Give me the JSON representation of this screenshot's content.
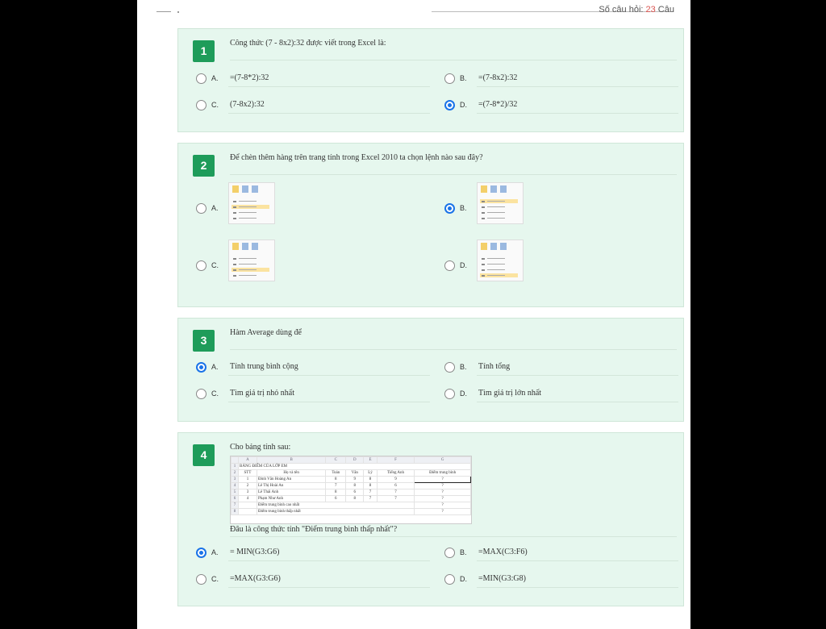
{
  "header": {
    "count_label": "Số câu hỏi: ",
    "count_value": "23",
    "count_unit": " Câu"
  },
  "questions": [
    {
      "number": "1",
      "text": "Công thức (7 - 8x2):32 được viết trong Excel là:",
      "options": [
        {
          "letter": "A.",
          "text": "=(7-8*2):32",
          "selected": false
        },
        {
          "letter": "B.",
          "text": "=(7-8x2):32",
          "selected": false
        },
        {
          "letter": "C.",
          "text": "(7-8x2):32",
          "selected": false
        },
        {
          "letter": "D.",
          "text": "=(7-8*2)/32",
          "selected": true
        }
      ]
    },
    {
      "number": "2",
      "text": "Để chèn thêm hàng trên trang tính trong Excel 2010 ta chọn lệnh nào sau đây?",
      "options": [
        {
          "letter": "A.",
          "highlight_row": 1,
          "selected": false
        },
        {
          "letter": "B.",
          "highlight_row": 0,
          "selected": true
        },
        {
          "letter": "C.",
          "highlight_row": 2,
          "selected": false
        },
        {
          "letter": "D.",
          "highlight_row": 3,
          "selected": false
        }
      ]
    },
    {
      "number": "3",
      "text": "Hàm Average dùng để",
      "options": [
        {
          "letter": "A.",
          "text": "Tính trung bình cộng",
          "selected": true
        },
        {
          "letter": "B.",
          "text": "Tính tổng",
          "selected": false
        },
        {
          "letter": "C.",
          "text": "Tìm giá trị nhỏ nhất",
          "selected": false
        },
        {
          "letter": "D.",
          "text": "Tìm giá trị lớn nhất",
          "selected": false
        }
      ]
    },
    {
      "number": "4",
      "text": "Cho bảng tính sau:",
      "sub_text": "Đâu là công thức tính \"Điểm trung bình thấp nhất\"?",
      "sheet": {
        "col_headers": [
          "A",
          "B",
          "C",
          "D",
          "E",
          "F",
          "G"
        ],
        "title": "BẢNG ĐIỂM CỦA LỚP EM",
        "headers": [
          "STT",
          "Họ và tên",
          "Toán",
          "Văn",
          "Lý",
          "Tiếng Anh",
          "Điểm trung bình"
        ],
        "rows": [
          [
            "1",
            "Đinh Văn Hoàng An",
            "8",
            "9",
            "8",
            "9",
            "?"
          ],
          [
            "2",
            "Lê Thị Hoài An",
            "7",
            "8",
            "8",
            "6",
            "?"
          ],
          [
            "3",
            "Lê Thái Anh",
            "8",
            "6",
            "7",
            "7",
            "?"
          ],
          [
            "4",
            "Phạm Như Anh",
            "6",
            "8",
            "7",
            "7",
            "?"
          ]
        ],
        "extra_rows": [
          {
            "label": "Điểm trung bình cao nhất",
            "value": "?"
          },
          {
            "label": "Điểm trung bình thấp nhất",
            "value": "?"
          }
        ]
      },
      "options": [
        {
          "letter": "A.",
          "text": "= MIN(G3:G6)",
          "selected": true
        },
        {
          "letter": "B.",
          "text": "=MAX(C3:F6)",
          "selected": false
        },
        {
          "letter": "C.",
          "text": "=MAX(G3:G6)",
          "selected": false
        },
        {
          "letter": "D.",
          "text": "=MIN(G3:G8)",
          "selected": false
        }
      ]
    }
  ]
}
